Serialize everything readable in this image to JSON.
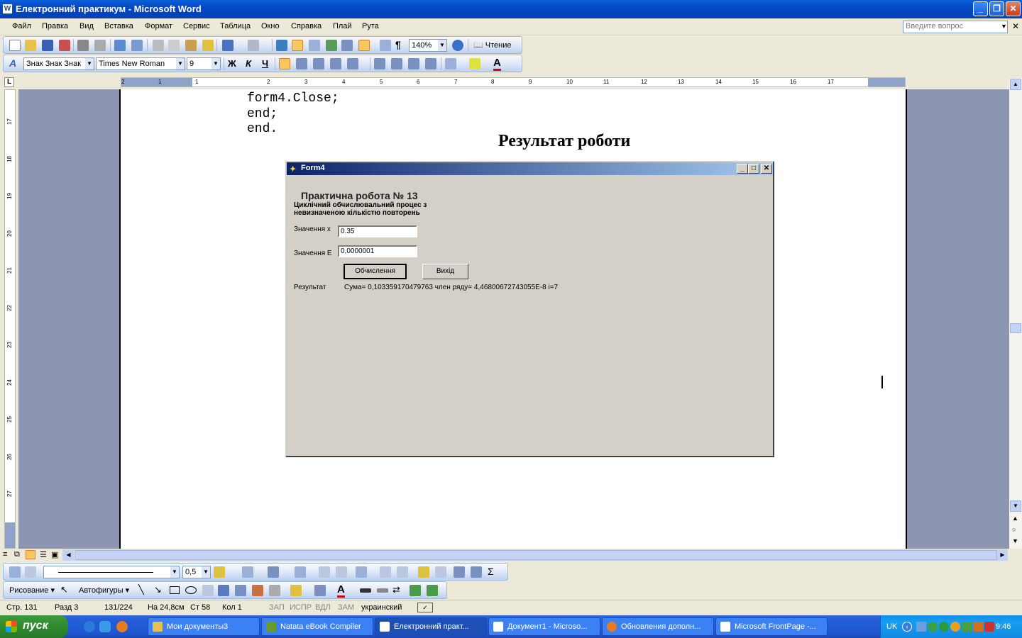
{
  "window": {
    "title": "Електронний практикум - Microsoft Word",
    "app_icon": "W"
  },
  "menu": {
    "items": [
      "Файл",
      "Правка",
      "Вид",
      "Вставка",
      "Формат",
      "Сервис",
      "Таблица",
      "Окно",
      "Справка",
      "Плай",
      "Рута"
    ],
    "ask_placeholder": "Введите вопрос"
  },
  "toolbar": {
    "zoom": "140%",
    "reading_label": "Чтение"
  },
  "format_bar": {
    "style": "Знак Знак Знак",
    "font": "Times New Roman",
    "size": "9",
    "bold": "Ж",
    "italic": "К",
    "underline": "Ч"
  },
  "ruler": {
    "h_ticks": [
      "2",
      "1",
      "1",
      "2",
      "3",
      "4",
      "5",
      "6",
      "7",
      "8",
      "9",
      "10",
      "11",
      "12",
      "13",
      "14",
      "15",
      "16",
      "17"
    ],
    "v_ticks": [
      "17",
      "18",
      "19",
      "20",
      "21",
      "22",
      "23",
      "24",
      "25",
      "26",
      "27",
      "28"
    ]
  },
  "document": {
    "code_lines": [
      "form4.Close;",
      "end;",
      "end."
    ],
    "heading": "Результат роботи"
  },
  "form4": {
    "caption": "Form4",
    "title": "Практична робота № 13",
    "subtitle_line1": "Циклічний обчислювальний процес з",
    "subtitle_line2": "невизначеною кількістю повторень",
    "x_label": "Значення x",
    "x_value": "0.35",
    "e_label": "Значення E",
    "e_value": "0,0000001",
    "calc_button": "Обчислення",
    "exit_button": "Вихід",
    "result_label": "Результат",
    "result_text": "Сума= 0,103359170479763 член ряду= 4,46800672743055E-8 i=7"
  },
  "drawing_bar": {
    "draw_label": "Рисование",
    "autoshapes_label": "Автофигуры",
    "line_width": "0,5"
  },
  "status": {
    "page": "Стр. 131",
    "section": "Разд 3",
    "pages": "131/224",
    "at": "На 24,8см",
    "line": "Ст 58",
    "col": "Кол 1",
    "rec": "ЗАП",
    "trk": "ИСПР",
    "ext": "ВДЛ",
    "ovr": "ЗАМ",
    "lang": "украинский"
  },
  "taskbar": {
    "start": "пуск",
    "tasks": [
      "Мои документы3",
      "Natata eBook Compiler",
      "Електронний практ...",
      "Документ1 - Microso...",
      "Обновления дополн...",
      "Microsoft FrontPage -..."
    ],
    "lang": "UK",
    "clock": "9:46"
  },
  "colors": {
    "titlebar": "#0a5fd9",
    "taskbar": "#245edb",
    "start": "#2f8a2f",
    "form_bg": "#d4d0c8",
    "doc_bg": "#8d96b0"
  }
}
